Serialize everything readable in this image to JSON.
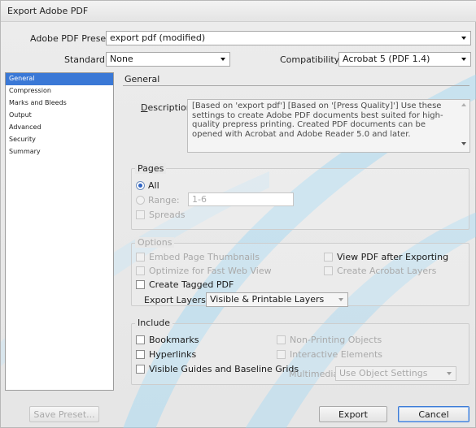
{
  "window": {
    "title": "Export Adobe PDF"
  },
  "preset": {
    "label": "Adobe PDF Preset:",
    "value": "export pdf (modified)"
  },
  "standard": {
    "label": "Standard:",
    "value": "None"
  },
  "compatibility": {
    "label": "Compatibility:",
    "value": "Acrobat 5 (PDF 1.4)"
  },
  "sidebar": {
    "items": [
      {
        "label": "General",
        "selected": true
      },
      {
        "label": "Compression",
        "selected": false
      },
      {
        "label": "Marks and Bleeds",
        "selected": false
      },
      {
        "label": "Output",
        "selected": false
      },
      {
        "label": "Advanced",
        "selected": false
      },
      {
        "label": "Security",
        "selected": false
      },
      {
        "label": "Summary",
        "selected": false
      }
    ]
  },
  "general": {
    "title": "General",
    "description_label": "Description:",
    "description_text": "[Based on 'export pdf'] [Based on '[Press Quality]'] Use these settings to create Adobe PDF documents best suited for high-quality prepress printing.  Created PDF documents can be opened with Acrobat and Adobe Reader 5.0 and later."
  },
  "pages": {
    "title": "Pages",
    "all_label": "All",
    "range_label": "Range:",
    "range_value": "1-6",
    "spreads_label": "Spreads"
  },
  "options": {
    "title": "Options",
    "embed_thumbnails": "Embed Page Thumbnails",
    "optimize_web": "Optimize for Fast Web View",
    "create_tagged": "Create Tagged PDF",
    "view_after": "View PDF after Exporting",
    "create_layers": "Create Acrobat Layers",
    "export_layers_label": "Export Layers:",
    "export_layers_value": "Visible & Printable Layers"
  },
  "include": {
    "title": "Include",
    "bookmarks": "Bookmarks",
    "hyperlinks": "Hyperlinks",
    "visible_guides": "Visible Guides and Baseline Grids",
    "non_printing": "Non-Printing Objects",
    "interactive": "Interactive Elements",
    "multimedia_label": "Multimedia:",
    "multimedia_value": "Use Object Settings"
  },
  "buttons": {
    "save_preset": "Save Preset...",
    "export": "Export",
    "cancel": "Cancel"
  },
  "colors": {
    "selection": "#3a78d6",
    "watermark": "#9ed8f5"
  }
}
